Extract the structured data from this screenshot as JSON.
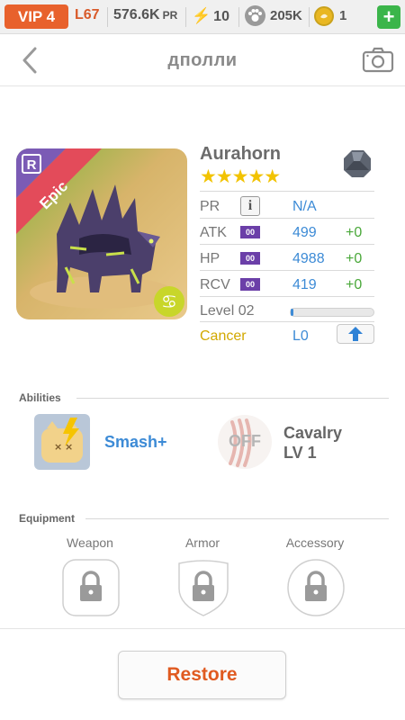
{
  "status": {
    "vip": "VIP 4",
    "level": "L67",
    "power": "576.6K",
    "power_unit": "PR",
    "energy": "10",
    "paws": "205K",
    "coins": "1",
    "plus": "+"
  },
  "header": {
    "title": "дполли"
  },
  "hero": {
    "rarity": "Epic",
    "rarity_badge": "R",
    "name": "Aurahorn",
    "stars": "★★★★★",
    "pr_label": "PR",
    "pr_value": "N/A",
    "info": "i",
    "stats": [
      {
        "label": "ATK",
        "badge": "00",
        "value": "499",
        "bonus": "+0"
      },
      {
        "label": "HP",
        "badge": "00",
        "value": "4988",
        "bonus": "+0"
      },
      {
        "label": "RCV",
        "badge": "00",
        "value": "419",
        "bonus": "+0"
      }
    ],
    "level_label": "Level 02",
    "level_progress": 0.03,
    "sign": "Cancer",
    "sign_level": "L0"
  },
  "abilities": {
    "label": "Abilities",
    "skill_name": "Smash+",
    "leader_state": "OFF",
    "leader_name": "Cavalry",
    "leader_level": "LV 1"
  },
  "equipment": {
    "label": "Equipment",
    "slots": [
      "Weapon",
      "Armor",
      "Accessory"
    ]
  },
  "actions": {
    "restore": "Restore"
  },
  "colors": {
    "accent": "#e05a20",
    "blue": "#3d8bd6",
    "green": "#4aa83a",
    "star": "#f2c300",
    "epic_ribbon": "#e34b5a"
  }
}
